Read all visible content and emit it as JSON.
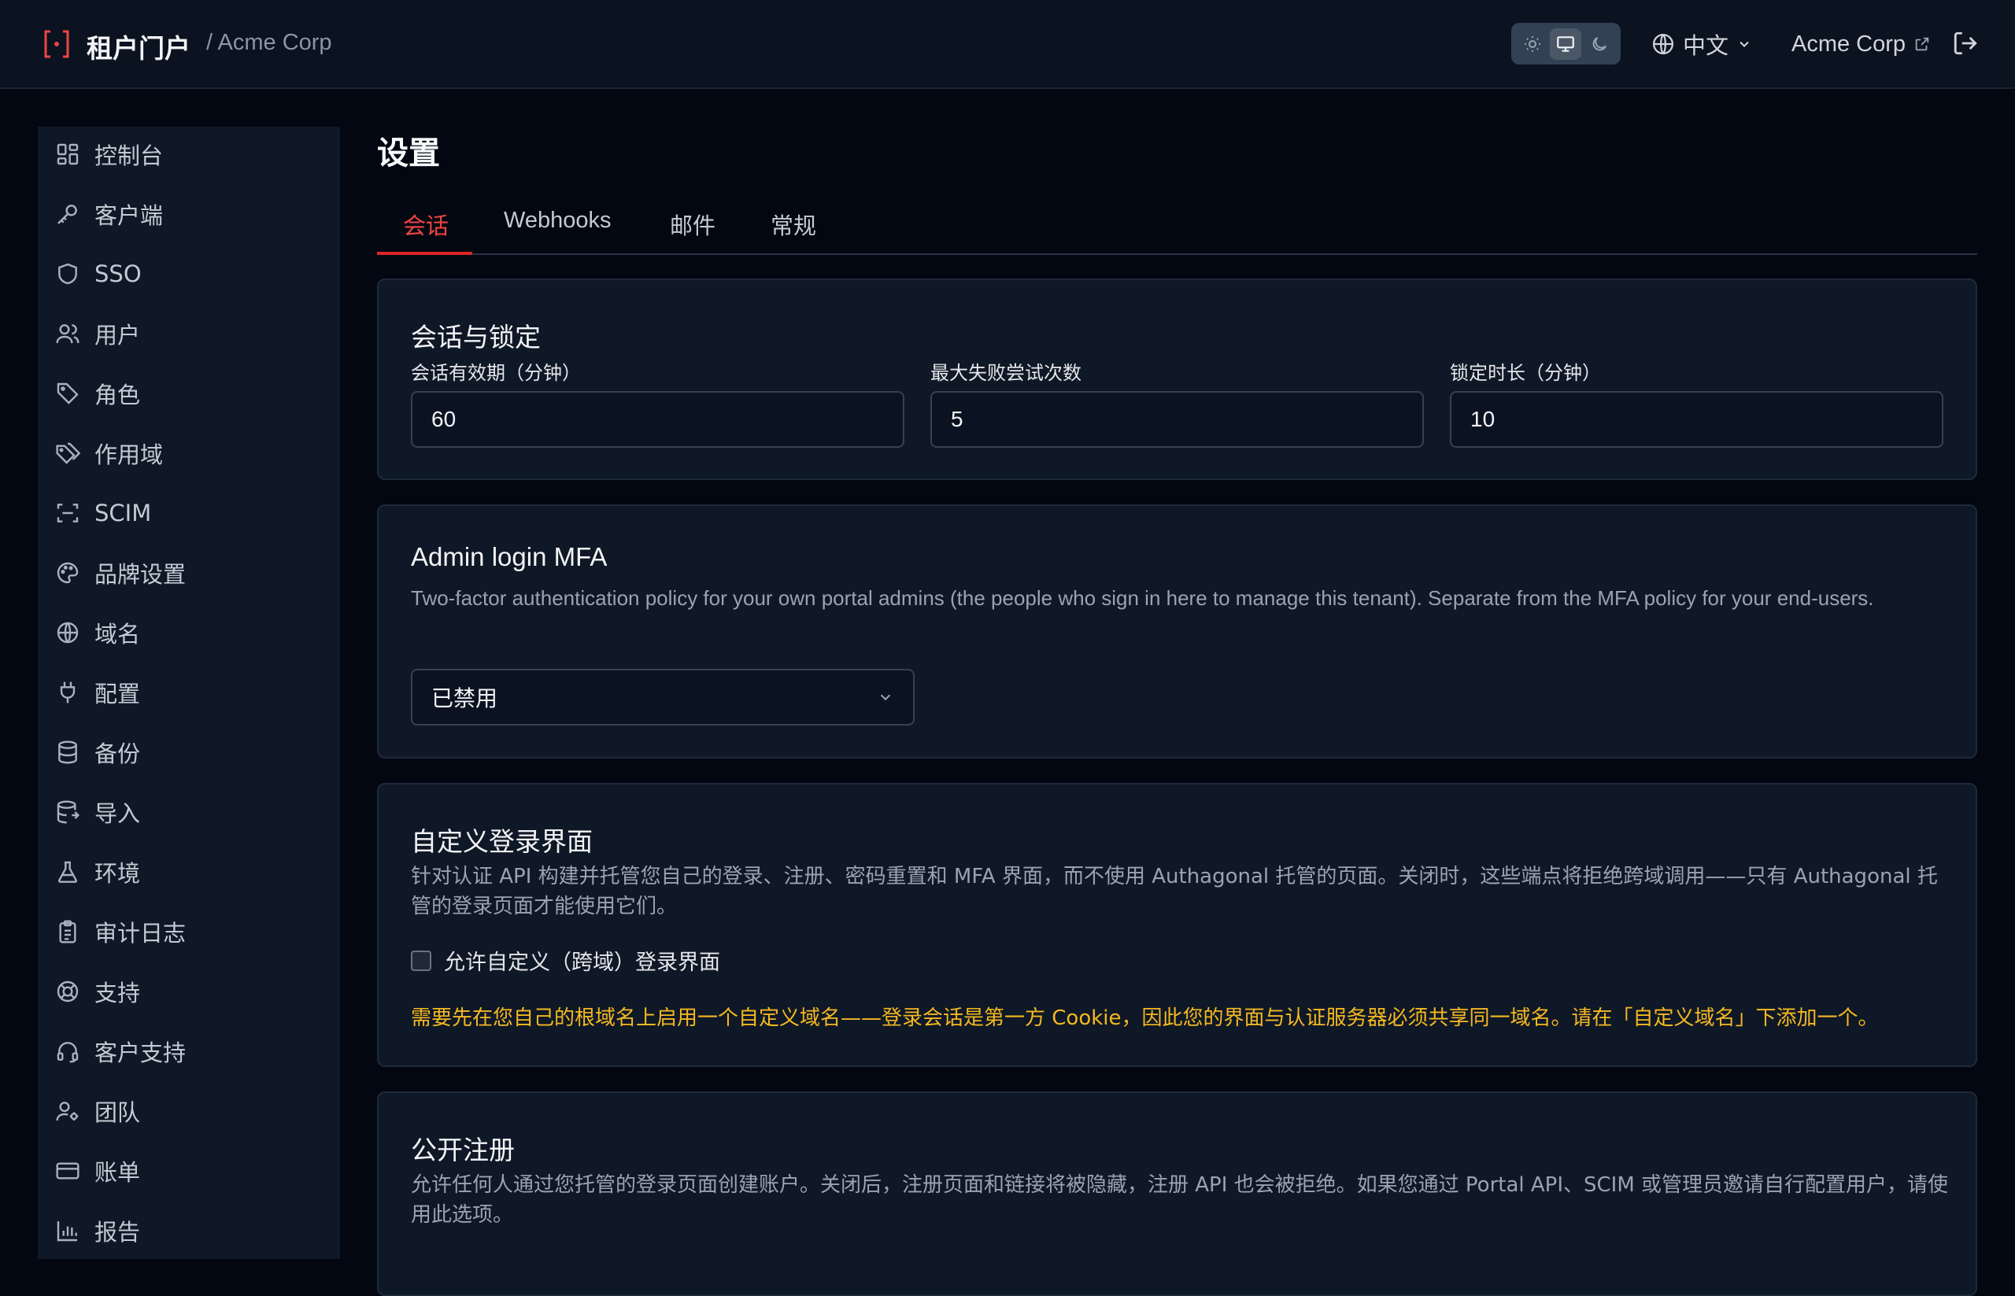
{
  "header": {
    "brand_title": "租户门户",
    "tenant_crumb": "/ Acme Corp",
    "language": "中文",
    "tenant_link": "Acme Corp",
    "theme_options": [
      "sun-icon",
      "monitor-icon",
      "moon-icon"
    ],
    "theme_selected": "monitor-icon"
  },
  "sidebar": {
    "items": [
      {
        "label": "控制台",
        "icon": "dashboard-icon"
      },
      {
        "label": "客户端",
        "icon": "key-icon"
      },
      {
        "label": "SSO",
        "icon": "shield-icon"
      },
      {
        "label": "用户",
        "icon": "users-icon"
      },
      {
        "label": "角色",
        "icon": "tag-icon"
      },
      {
        "label": "作用域",
        "icon": "tags-icon"
      },
      {
        "label": "SCIM",
        "icon": "scan-icon"
      },
      {
        "label": "品牌设置",
        "icon": "palette-icon"
      },
      {
        "label": "域名",
        "icon": "globe-icon"
      },
      {
        "label": "配置",
        "icon": "plug-icon"
      },
      {
        "label": "备份",
        "icon": "database-icon"
      },
      {
        "label": "导入",
        "icon": "database-import-icon"
      },
      {
        "label": "环境",
        "icon": "flask-icon"
      },
      {
        "label": "审计日志",
        "icon": "clipboard-icon"
      },
      {
        "label": "支持",
        "icon": "lifebuoy-icon"
      },
      {
        "label": "客户支持",
        "icon": "headset-icon"
      },
      {
        "label": "团队",
        "icon": "user-cog-icon"
      },
      {
        "label": "账单",
        "icon": "credit-card-icon"
      },
      {
        "label": "报告",
        "icon": "bar-chart-icon"
      }
    ]
  },
  "main": {
    "title": "设置",
    "tabs": [
      {
        "label": "会话",
        "active": true
      },
      {
        "label": "Webhooks",
        "active": false
      },
      {
        "label": "邮件",
        "active": false
      },
      {
        "label": "常规",
        "active": false
      }
    ],
    "session_card": {
      "title": "会话与锁定",
      "fields": [
        {
          "label": "会话有效期（分钟）",
          "value": "60"
        },
        {
          "label": "最大失败尝试次数",
          "value": "5"
        },
        {
          "label": "锁定时长（分钟）",
          "value": "10"
        }
      ]
    },
    "mfa_card": {
      "title": "Admin login MFA",
      "desc": "Two-factor authentication policy for your own portal admins (the people who sign in here to manage this tenant). Separate from the MFA policy for your end-users.",
      "select_value": "已禁用"
    },
    "custom_login_card": {
      "title": "自定义登录界面",
      "desc": "针对认证 API 构建并托管您自己的登录、注册、密码重置和 MFA 界面，而不使用 Authagonal 托管的页面。关闭时，这些端点将拒绝跨域调用——只有 Authagonal 托管的登录页面才能使用它们。",
      "checkbox_label": "允许自定义（跨域）登录界面",
      "checkbox_checked": false,
      "warning": "需要先在您自己的根域名上启用一个自定义域名——登录会话是第一方 Cookie，因此您的界面与认证服务器必须共享同一域名。请在「自定义域名」下添加一个。"
    },
    "public_signup_card": {
      "title": "公开注册",
      "desc": "允许任何人通过您托管的登录页面创建账户。关闭后，注册页面和链接将被隐藏，注册 API 也会被拒绝。如果您通过 Portal API、SCIM 或管理员邀请自行配置用户，请使用此选项。"
    }
  },
  "colors": {
    "accent": "#dc2626",
    "warning": "#f5b821",
    "background": "#030712",
    "panel": "#0f1826"
  }
}
